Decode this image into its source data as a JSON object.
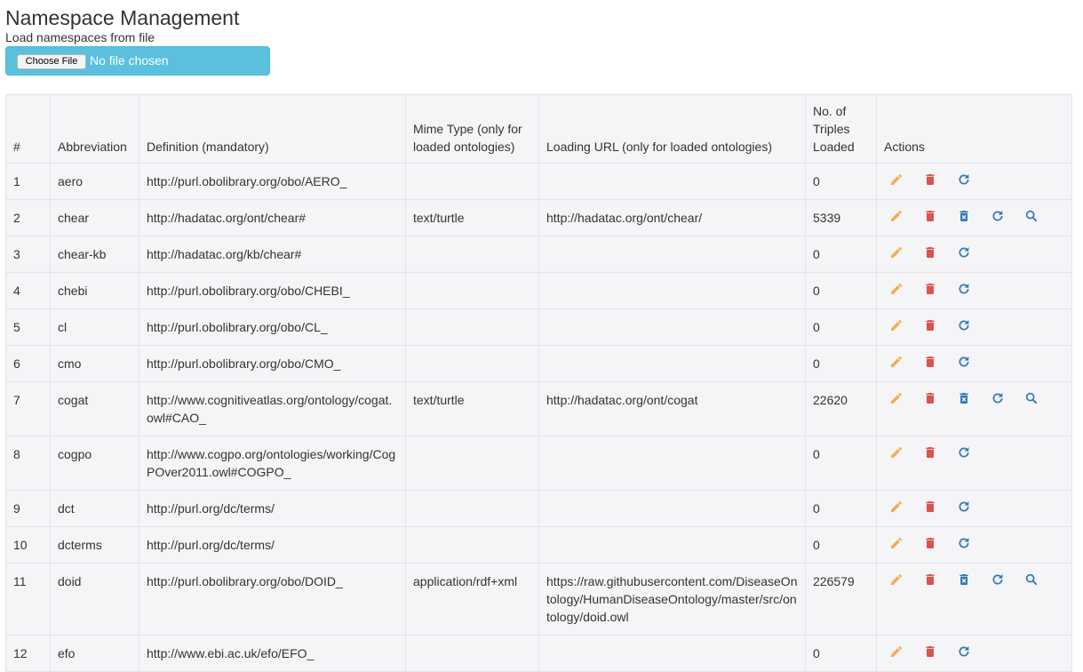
{
  "page": {
    "title": "Namespace Management",
    "load_label": "Load namespaces from file",
    "file_button": "Choose File",
    "file_status": "No file chosen"
  },
  "colors": {
    "edit": "#f0ad4e",
    "delete": "#d9534f",
    "action_blue": "#337ab7",
    "file_box": "#5bc0de"
  },
  "table": {
    "headers": {
      "num": "#",
      "abbrev": "Abbreviation",
      "definition": "Definition (mandatory)",
      "mime": "Mime Type (only for loaded ontologies)",
      "url": "Loading URL (only for loaded ontologies)",
      "triples": "No. of Triples Loaded",
      "actions": "Actions"
    },
    "rows": [
      {
        "num": "1",
        "abbrev": "aero",
        "definition": "http://purl.obolibrary.org/obo/AERO_",
        "mime": "",
        "url": "",
        "triples": "0",
        "icons": [
          "pencil-icon",
          "trash-icon",
          "refresh-icon"
        ]
      },
      {
        "num": "2",
        "abbrev": "chear",
        "definition": "http://hadatac.org/ont/chear#",
        "mime": "text/turtle",
        "url": "http://hadatac.org/ont/chear/",
        "triples": "5339",
        "icons": [
          "pencil-icon",
          "trash-icon",
          "delete-box-icon",
          "refresh-icon",
          "search-icon"
        ]
      },
      {
        "num": "3",
        "abbrev": "chear-kb",
        "definition": "http://hadatac.org/kb/chear#",
        "mime": "",
        "url": "",
        "triples": "0",
        "icons": [
          "pencil-icon",
          "trash-icon",
          "refresh-icon"
        ]
      },
      {
        "num": "4",
        "abbrev": "chebi",
        "definition": "http://purl.obolibrary.org/obo/CHEBI_",
        "mime": "",
        "url": "",
        "triples": "0",
        "icons": [
          "pencil-icon",
          "trash-icon",
          "refresh-icon"
        ]
      },
      {
        "num": "5",
        "abbrev": "cl",
        "definition": "http://purl.obolibrary.org/obo/CL_",
        "mime": "",
        "url": "",
        "triples": "0",
        "icons": [
          "pencil-icon",
          "trash-icon",
          "refresh-icon"
        ]
      },
      {
        "num": "6",
        "abbrev": "cmo",
        "definition": "http://purl.obolibrary.org/obo/CMO_",
        "mime": "",
        "url": "",
        "triples": "0",
        "icons": [
          "pencil-icon",
          "trash-icon",
          "refresh-icon"
        ]
      },
      {
        "num": "7",
        "abbrev": "cogat",
        "definition": "http://www.cognitiveatlas.org/ontology/cogat.owl#CAO_",
        "mime": "text/turtle",
        "url": "http://hadatac.org/ont/cogat",
        "triples": "22620",
        "icons": [
          "pencil-icon",
          "trash-icon",
          "delete-box-icon",
          "refresh-icon",
          "search-icon"
        ]
      },
      {
        "num": "8",
        "abbrev": "cogpo",
        "definition": "http://www.cogpo.org/ontologies/working/CogPOver2011.owl#COGPO_",
        "mime": "",
        "url": "",
        "triples": "0",
        "icons": [
          "pencil-icon",
          "trash-icon",
          "refresh-icon"
        ]
      },
      {
        "num": "9",
        "abbrev": "dct",
        "definition": "http://purl.org/dc/terms/",
        "mime": "",
        "url": "",
        "triples": "0",
        "icons": [
          "pencil-icon",
          "trash-icon",
          "refresh-icon"
        ]
      },
      {
        "num": "10",
        "abbrev": "dcterms",
        "definition": "http://purl.org/dc/terms/",
        "mime": "",
        "url": "",
        "triples": "0",
        "icons": [
          "pencil-icon",
          "trash-icon",
          "refresh-icon"
        ]
      },
      {
        "num": "11",
        "abbrev": "doid",
        "definition": "http://purl.obolibrary.org/obo/DOID_",
        "mime": "application/rdf+xml",
        "url": "https://raw.githubusercontent.com/DiseaseOntology/HumanDiseaseOntology/master/src/ontology/doid.owl",
        "triples": "226579",
        "icons": [
          "pencil-icon",
          "trash-icon",
          "delete-box-icon",
          "refresh-icon",
          "search-icon"
        ]
      },
      {
        "num": "12",
        "abbrev": "efo",
        "definition": "http://www.ebi.ac.uk/efo/EFO_",
        "mime": "",
        "url": "",
        "triples": "0",
        "icons": [
          "pencil-icon",
          "trash-icon",
          "refresh-icon"
        ]
      }
    ]
  }
}
